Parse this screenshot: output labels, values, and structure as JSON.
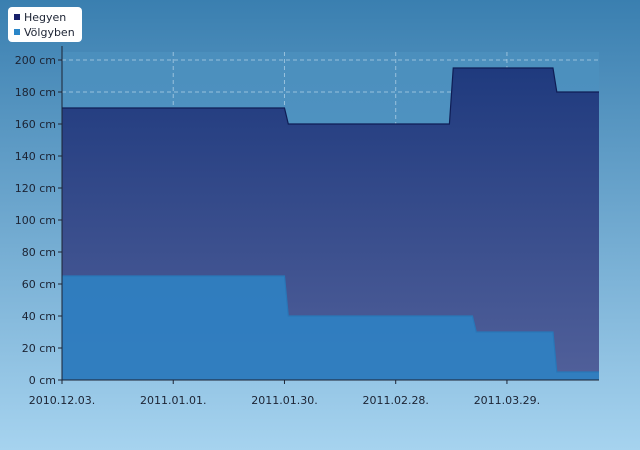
{
  "chart_data": {
    "type": "area",
    "title": "",
    "xlabel": "",
    "ylabel": "",
    "x_ticks": [
      "2010.12.03.",
      "2011.01.01.",
      "2011.01.30.",
      "2011.02.28.",
      "2011.03.29."
    ],
    "y_ticks": [
      "0 cm",
      "20 cm",
      "40 cm",
      "60 cm",
      "80 cm",
      "100 cm",
      "120 cm",
      "140 cm",
      "160 cm",
      "180 cm",
      "200 cm"
    ],
    "xlim": [
      "2010-12-03",
      "2011-04-22"
    ],
    "ylim": [
      0,
      205
    ],
    "grid": true,
    "legend": "top-left",
    "series": [
      {
        "name": "Hegyen",
        "color": "#20357a",
        "points": [
          [
            "2010-12-03",
            170
          ],
          [
            "2011-01-30",
            170
          ],
          [
            "2011-01-31",
            160
          ],
          [
            "2011-03-14",
            160
          ],
          [
            "2011-03-15",
            195
          ],
          [
            "2011-04-10",
            195
          ],
          [
            "2011-04-11",
            180
          ],
          [
            "2011-04-22",
            180
          ]
        ]
      },
      {
        "name": "Völgyben",
        "color": "#2f7fc1",
        "points": [
          [
            "2010-12-03",
            65
          ],
          [
            "2011-01-30",
            65
          ],
          [
            "2011-01-31",
            40
          ],
          [
            "2011-03-20",
            40
          ],
          [
            "2011-03-21",
            30
          ],
          [
            "2011-04-10",
            30
          ],
          [
            "2011-04-11",
            5
          ],
          [
            "2011-04-22",
            5
          ]
        ]
      }
    ]
  }
}
